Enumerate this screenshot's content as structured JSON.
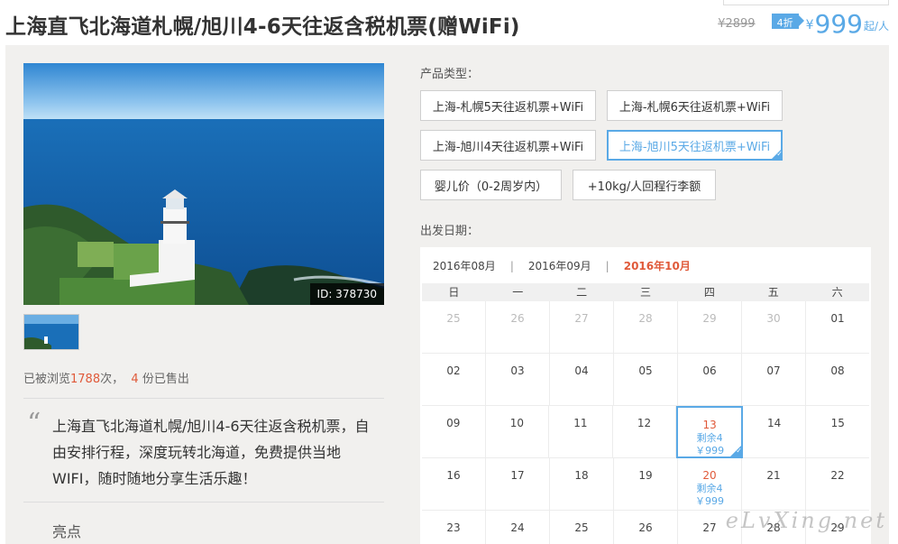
{
  "header": {
    "title": "上海直飞北海道札幌/旭川4-6天往返含税机票(赠WiFi)",
    "price_old": "¥2899",
    "discount": "4折",
    "currency": "¥",
    "price_new": "999",
    "price_unit": "起/人"
  },
  "gallery": {
    "photo_id": "ID: 378730"
  },
  "stats": {
    "prefix": "已被浏览",
    "views": "1788",
    "mid": "次，",
    "sold": "4",
    "suffix": "份已售出"
  },
  "description": {
    "quote": "上海直飞北海道札幌/旭川4-6天往返含税机票，自由安排行程，深度玩转北海道，免费提供当地WIFI，随时随地分享生活乐趣！",
    "highlights_title": "亮点"
  },
  "product": {
    "label": "产品类型：",
    "options": [
      {
        "label": "上海-札幌5天往返机票+WiFi"
      },
      {
        "label": "上海-札幌6天往返机票+WiFi"
      },
      {
        "label": "上海-旭川4天往返机票+WiFi"
      },
      {
        "label": "上海-旭川5天往返机票+WiFi"
      },
      {
        "label": "婴儿价（0-2周岁内）"
      },
      {
        "label": "+10kg/人回程行李额"
      }
    ]
  },
  "departure": {
    "label": "出发日期：",
    "months": [
      "2016年08月",
      "2016年09月",
      "2016年10月"
    ],
    "separator": "|",
    "weekdays": [
      "日",
      "一",
      "二",
      "三",
      "四",
      "五",
      "六"
    ],
    "weeks": [
      [
        "25",
        "26",
        "27",
        "28",
        "29",
        "30",
        "01"
      ],
      [
        "02",
        "03",
        "04",
        "05",
        "06",
        "07",
        "08"
      ],
      [
        "09",
        "10",
        "11",
        "12",
        "13",
        "14",
        "15"
      ],
      [
        "16",
        "17",
        "18",
        "19",
        "20",
        "21",
        "22"
      ],
      [
        "23",
        "24",
        "25",
        "26",
        "27",
        "28",
        "29"
      ]
    ],
    "avail_13": {
      "stock": "剩余4",
      "price": "￥999"
    },
    "avail_20": {
      "stock": "剩余4",
      "price": "￥999"
    }
  },
  "watermark": "eLvXing.net",
  "colors": {
    "accent": "#5aa9e6",
    "highlight": "#e05a3a",
    "panel": "#f1f0ee"
  }
}
